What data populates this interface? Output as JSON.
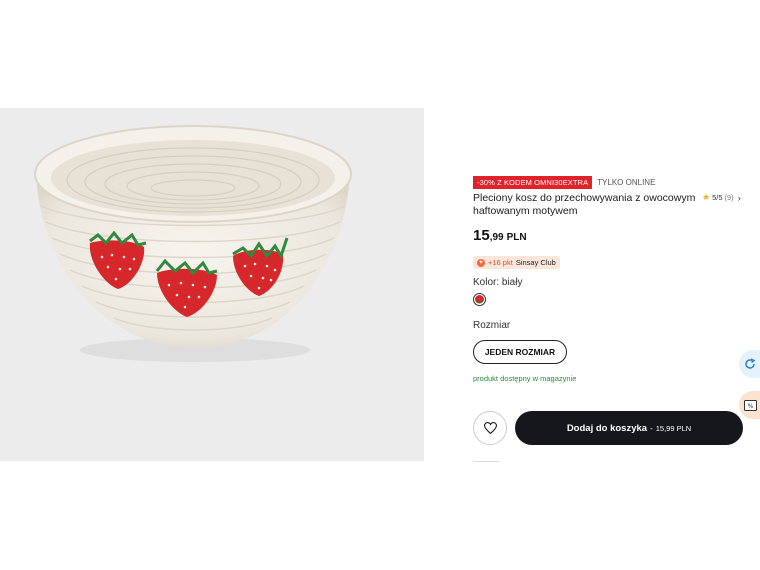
{
  "product": {
    "promo_badge": "-30% Z KODEM OMNI30EXTRA",
    "online_label": "TYLKO ONLINE",
    "title": "Pleciony kosz do przechowywania z owocowym haftowanym motywem",
    "rating": {
      "score": "5/5",
      "count": "(9)",
      "stars": 1
    },
    "price": {
      "integer": "15",
      "decimal": ",99",
      "currency": "PLN"
    },
    "club": {
      "points": "+16 pkt",
      "name": "Sinsay Club"
    },
    "color_label": "Kolor: biały",
    "size_label": "Rozmiar",
    "size_option": "JEDEN ROZMIAR",
    "availability": "produkt dostępny w magazynie",
    "cart_button": {
      "label": "Dodaj do koszyka",
      "separator": "-",
      "price": "15,99 PLN"
    }
  },
  "icons": {
    "star": "star-icon",
    "chevron": "chevron-right-icon",
    "wishlist": "heart-icon",
    "club": "club-icon",
    "chat": "chat-icon",
    "promo": "promo-icon"
  },
  "colors": {
    "promo_badge": "#e0232b",
    "availability": "#2f8a3e",
    "cart_button": "#16171d",
    "club_bg": "#fbe6dc",
    "star": "#f2b01e"
  }
}
